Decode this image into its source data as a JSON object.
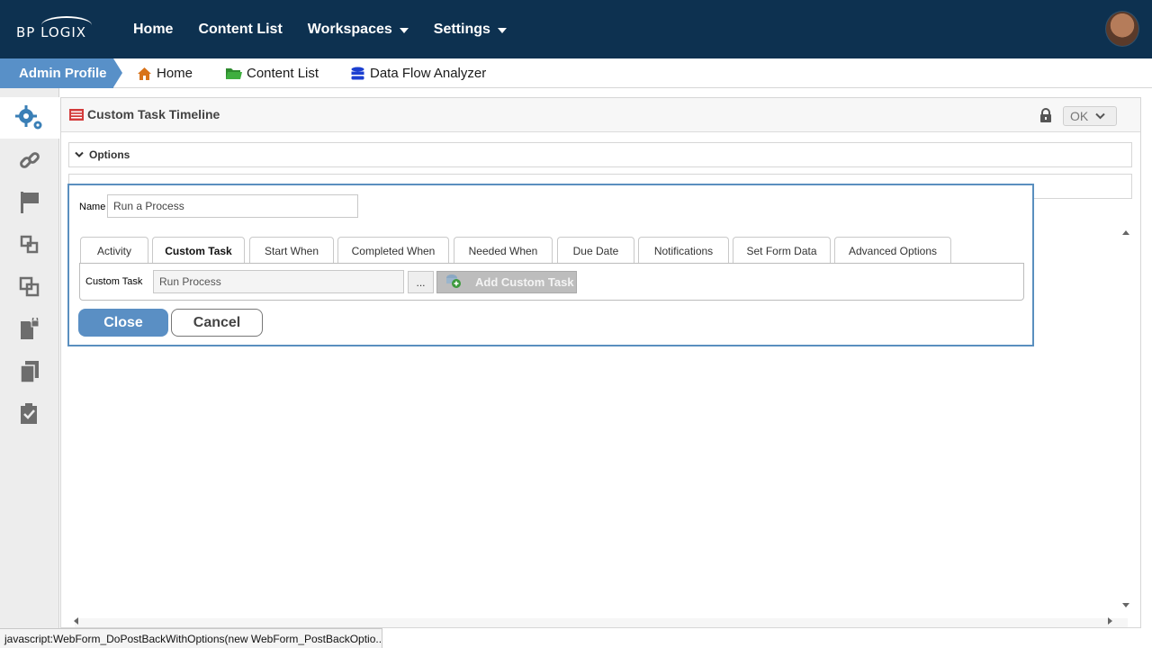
{
  "topbar": {
    "logo_text": "BP LOGIX",
    "nav": [
      {
        "label": "Home"
      },
      {
        "label": "Content List"
      },
      {
        "label": "Workspaces"
      },
      {
        "label": "Settings"
      }
    ]
  },
  "breadcrumb": {
    "admin_profile": "Admin Profile",
    "items": [
      {
        "label": "Home",
        "icon": "home-icon"
      },
      {
        "label": "Content List",
        "icon": "folder-icon"
      },
      {
        "label": "Data Flow Analyzer",
        "icon": "database-icon"
      }
    ]
  },
  "sidebar": {
    "items": [
      {
        "icon": "gears-icon",
        "active": true
      },
      {
        "icon": "link-icon"
      },
      {
        "icon": "flag-icon"
      },
      {
        "icon": "copy-squares-icon"
      },
      {
        "icon": "overlap-squares-icon"
      },
      {
        "icon": "locked-document-icon"
      },
      {
        "icon": "documents-icon"
      },
      {
        "icon": "checklist-icon"
      }
    ]
  },
  "panel": {
    "title": "Custom Task Timeline",
    "ok_label": "OK",
    "options_label": "Options"
  },
  "dialog": {
    "name_label": "Name",
    "name_value": "Run a Process",
    "tabs": [
      {
        "label": "Activity"
      },
      {
        "label": "Custom Task",
        "active": true
      },
      {
        "label": "Start When"
      },
      {
        "label": "Completed When"
      },
      {
        "label": "Needed When"
      },
      {
        "label": "Due Date"
      },
      {
        "label": "Notifications"
      },
      {
        "label": "Set Form Data"
      },
      {
        "label": "Advanced Options"
      }
    ],
    "custom_task_label": "Custom Task",
    "custom_task_value": "Run Process",
    "browse_label": "...",
    "add_custom_task_label": "Add Custom Task",
    "close_label": "Close",
    "cancel_label": "Cancel"
  },
  "status_bar": {
    "text": "javascript:WebForm_DoPostBackWithOptions(new WebForm_PostBackOptio..."
  },
  "colors": {
    "topbar": "#0d3150",
    "accent": "#5890c8",
    "dialog_border": "#5a8fbf"
  }
}
